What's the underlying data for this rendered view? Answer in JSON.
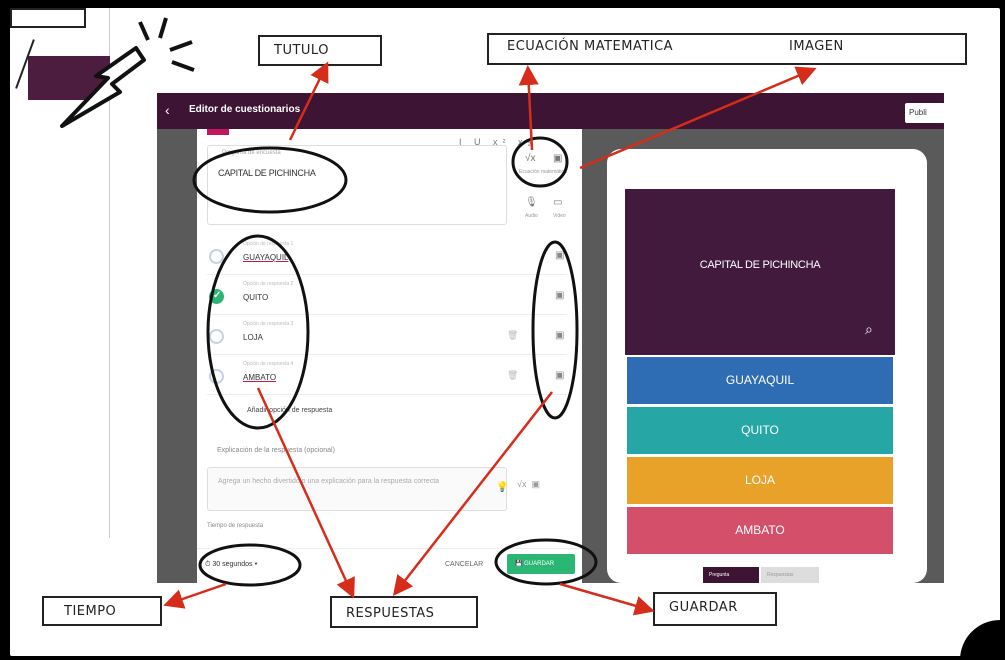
{
  "app": {
    "title": "Editor de cuestionarios",
    "publish_label": "Publi",
    "back_icon": "chevron-left-icon"
  },
  "editor": {
    "toolbar": "I U x² x₂",
    "question_label": "Pregunta de encuesta",
    "question_text": "CAPITAL DE PICHINCHA",
    "side_captions": {
      "equation": "Ecuación matemática",
      "image": "Imagen",
      "audio": "Audio",
      "video": "Video"
    },
    "answers": [
      {
        "label": "Opción de respuesta 1",
        "text": "GUAYAQUIL",
        "correct": false
      },
      {
        "label": "Opción de respuesta 2",
        "text": "QUITO",
        "correct": true
      },
      {
        "label": "Opción de respuesta 3",
        "text": "LOJA",
        "correct": false
      },
      {
        "label": "Opción de respuesta 4",
        "text": "AMBATO",
        "correct": false
      }
    ],
    "add_answer": "Añadir opción de respuesta",
    "explanation_label": "Explicación de la respuesta (opcional)",
    "explanation_placeholder": "Agrega un hecho divertido o una explicación para la respuesta correcta",
    "time_label": "Tiempo de respuesta",
    "time_value": "30 segundos",
    "cancel_label": "CANCELAR",
    "save_label": "GUARDAR"
  },
  "preview": {
    "question": "CAPITAL DE PICHINCHA",
    "options": [
      "GUAYAQUIL",
      "QUITO",
      "LOJA",
      "AMBATO"
    ],
    "tab_a": "Pregunta",
    "tab_b": "Respuestas"
  },
  "callouts": {
    "tutulo": "TUTULO",
    "ecuacion": "ECUACIÓN MATEMATICA",
    "imagen": "IMAGEN",
    "tiempo": "TIEMPO",
    "respuestas": "RESPUESTAS",
    "guardar": "GUARDAR"
  },
  "colors": {
    "header": "#3d1434",
    "correct": "#2bb673",
    "arrow": "#d62c1a",
    "opt_blue": "#2e6db4",
    "opt_teal": "#27a6a6",
    "opt_yellow": "#e8a22a",
    "opt_red": "#d4506a"
  }
}
